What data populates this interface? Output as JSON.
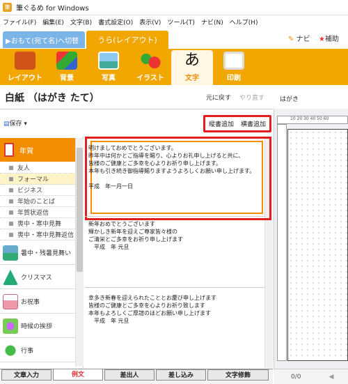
{
  "app": {
    "title": "筆ぐるめ for Windows"
  },
  "menu": [
    "ファイル(F)",
    "編集(E)",
    "文字(B)",
    "書式設定(O)",
    "表示(V)",
    "ツール(T)",
    "ナビ(N)",
    "ヘルプ(H)"
  ],
  "tabs": {
    "omote": "▶おもて(宛て名)へ切替",
    "ura": "うら(レイアウト)"
  },
  "help": {
    "navi": "ナビ",
    "hojo": "補助"
  },
  "toolbar": [
    "レイアウト",
    "背景",
    "写真",
    "イラスト",
    "文字",
    "印刷"
  ],
  "toolbar_active_index": 4,
  "page": {
    "title": "白紙 （はがき たて）",
    "undo": "元に戻す",
    "redo": "やり直す",
    "preview_label": "はがき"
  },
  "save_label": "保存",
  "add_buttons": {
    "vertical": "縦書追加",
    "horizontal": "横書追加"
  },
  "categories": {
    "nenga": "年賀",
    "subitems": [
      "友人",
      "フォーマル",
      "ビジネス",
      "年始のことば",
      "年賀状返信",
      "喪中・寒中見舞",
      "喪中・寒中見舞返信"
    ],
    "selected_sub": 1,
    "others": [
      "暑中・残暑見舞い",
      "クリスマス",
      "お祝事",
      "時候の挨拶",
      "行事"
    ]
  },
  "samples": [
    [
      "明けましておめでとうございます。",
      "昨年中は何かとご指導を賜り、心よりお礼申し上げると共に、",
      "皆様のご健康とご多幸を心よりお祈り申し上げます。",
      "本年も引き続き御指導賜りますようよろしくお願い申し上げます。",
      "",
      "平成　年一月一日"
    ],
    [
      "新年おめでとうございます",
      "輝かしき新年を迎えご尊家皆々様の",
      "ご清栄とご多幸をお祈り申し上げます",
      "　平成　年 元旦"
    ],
    [
      "幸多き新春を迎えられたこととお慶び申し上げます",
      "皆様のご健康とご多幸を心よりお祈り致します",
      "本年もよろしくご厚諠のほどお願い申し上げます",
      "　平成　年 元旦"
    ]
  ],
  "bottom_tabs": [
    "文章入力",
    "例文",
    "差出人",
    "差し込み",
    "文字修飾"
  ],
  "bottom_active": 1,
  "pager": "0/0",
  "ruler_marks": "10 20 30 40 50 60"
}
